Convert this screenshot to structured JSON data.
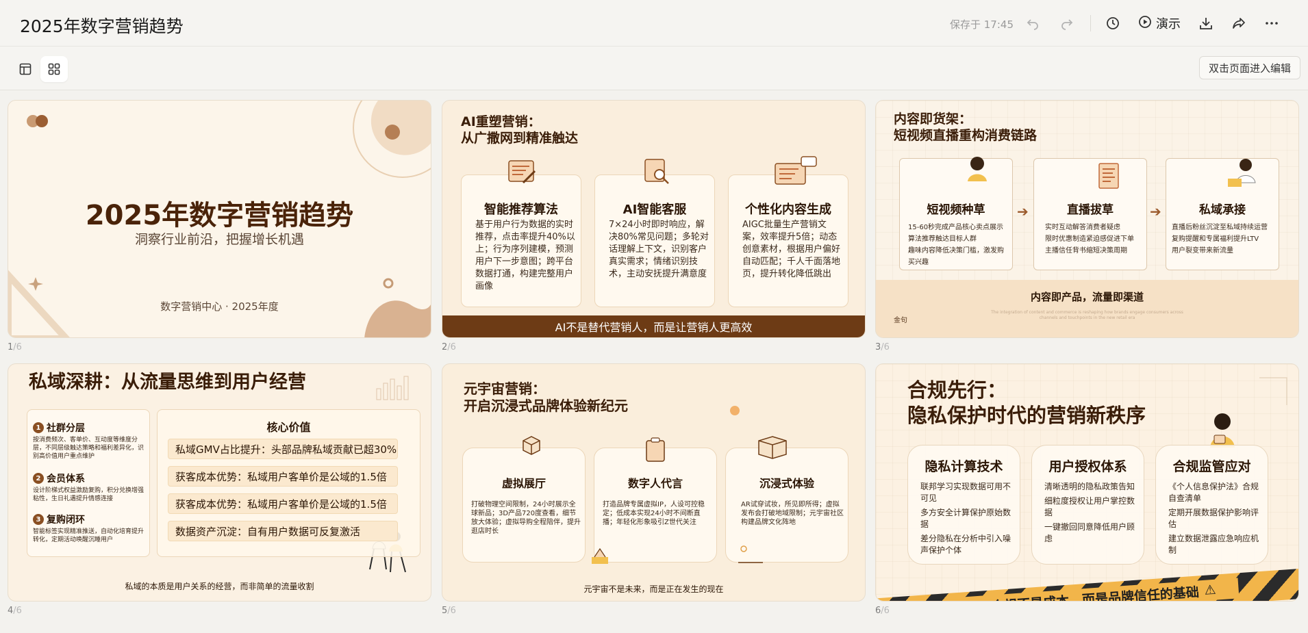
{
  "toolbar": {
    "doc_title": "2025年数字营销趋势",
    "save_status": "保存于 17:45",
    "present_label": "演示",
    "edit_hint": "双击页面进入编辑",
    "icons": [
      "undo-icon",
      "redo-icon",
      "history-icon",
      "play-icon",
      "download-icon",
      "share-icon",
      "more-icon",
      "layout-icon",
      "grid-view-icon"
    ]
  },
  "slides": {
    "total": "/6",
    "s1": {
      "num": "1",
      "title": "2025年数字营销趋势",
      "subtitle": "洞察行业前沿，把握增长机遇",
      "org": "数字营销中心 · 2025年度"
    },
    "s2": {
      "num": "2",
      "title_line1": "AI重塑营销：",
      "title_line2": "从广撒网到精准触达",
      "cards": [
        {
          "title": "智能推荐算法",
          "text": "基于用户行为数据的实时推荐，点击率提升40%以上；行为序列建模，预测用户下一步意图；跨平台数据打通，构建完整用户画像"
        },
        {
          "title": "AI智能客服",
          "text": "7×24小时即时响应，解决80%常见问题；多轮对话理解上下文，识别客户真实需求；情绪识别技术，主动安抚提升满意度"
        },
        {
          "title": "个性化内容生成",
          "text": "AIGC批量生产营销文案，效率提升5倍；动态创意素材，根据用户偏好自动匹配；千人千面落地页，提升转化降低跳出"
        }
      ],
      "footer": "AI不是替代营销人，而是让营销人更高效"
    },
    "s3": {
      "num": "3",
      "title_line1": "内容即货架：",
      "title_line2": "短视频直播重构消费链路",
      "cards": [
        {
          "title": "短视频种草",
          "lines": [
            "15-60秒完成产品核心卖点展示",
            "算法推荐触达目标人群",
            "趣味内容降低决策门槛，激发购买兴趣"
          ]
        },
        {
          "title": "直播拔草",
          "lines": [
            "实时互动解答消费者疑虑",
            "限时优惠制造紧迫感促进下单",
            "主播信任背书缩短决策周期"
          ]
        },
        {
          "title": "私域承接",
          "lines": [
            "直播后粉丝沉淀至私域持续运营",
            "复购提醒和专属福利提升LTV",
            "用户裂变带来新流量"
          ]
        }
      ],
      "bottom_title": "内容即产品，流量即渠道",
      "bottom_label": "金句",
      "bottom_fine": "The integration of content and commerce is reshaping how brands engage consumers across channels and touchpoints in the new retail era"
    },
    "s4": {
      "num": "4",
      "title": "私域深耕：从流量思维到用户经营",
      "items": [
        {
          "n": "1",
          "title": "社群分层",
          "text": "按消费频次、客单价、互动度等维度分层，不同层级触达策略和福利差异化，识别高价值用户重点维护"
        },
        {
          "n": "2",
          "title": "会员体系",
          "text": "设计阶梯式权益激励复购，积分兑换增强粘性，生日礼遇提升情感连接"
        },
        {
          "n": "3",
          "title": "复购闭环",
          "text": "智能标签实现精准推送，自动化培育提升转化，定期活动唤醒沉睡用户"
        }
      ],
      "core_title": "核心价值",
      "core_rows": [
        "私域GMV占比提升：头部品牌私域贡献已超30%",
        "获客成本优势：私域用户客单价是公域的1.5倍",
        "获客成本优势：私域用户客单价是公域的1.5倍",
        "数据资产沉淀：自有用户数据可反复激活"
      ],
      "footer": "私域的本质是用户关系的经营，而非简单的流量收割"
    },
    "s5": {
      "num": "5",
      "title_line1": "元宇宙营销：",
      "title_line2": "开启沉浸式品牌体验新纪元",
      "cards": [
        {
          "title": "虚拟展厅",
          "text": "打破物理空间限制，24小时展示全球新品；3D产品720度查看，细节放大体验；虚拟导购全程陪伴，提升逛店时长"
        },
        {
          "title": "数字人代言",
          "text": "打造品牌专属虚拟IP，人设可控稳定；低成本实现24小时不间断直播；年轻化形象吸引Z世代关注"
        },
        {
          "title": "沉浸式体验",
          "text": "AR试穿试妆，所见即所得；虚拟发布会打破地域限制；元宇宙社区构建品牌文化阵地"
        }
      ],
      "footer": "元宇宙不是未来，而是正在发生的现在"
    },
    "s6": {
      "num": "6",
      "title_line1": "合规先行：",
      "title_line2": "隐私保护时代的营销新秩序",
      "cards": [
        {
          "title": "隐私计算技术",
          "lines": [
            "联邦学习实现数据可用不可见",
            "多方安全计算保护原始数据",
            "差分隐私在分析中引入噪声保护个体"
          ]
        },
        {
          "title": "用户授权体系",
          "lines": [
            "清晰透明的隐私政策告知",
            "细粒度授权让用户掌控数据",
            "一键撤回同意降低用户顾虑"
          ]
        },
        {
          "title": "合规监管应对",
          "lines": [
            "《个人信息保护法》合规自查清单",
            "定期开展数据保护影响评估",
            "建立数据泄露应急响应机制"
          ]
        }
      ],
      "band": "合规不是成本，而是品牌信任的基础"
    }
  }
}
